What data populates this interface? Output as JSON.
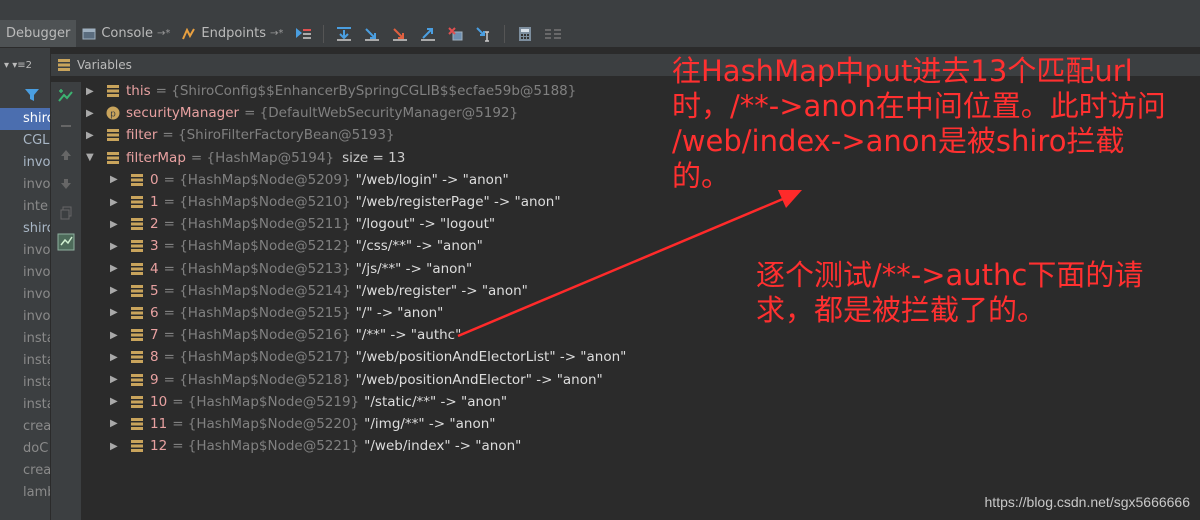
{
  "toolbar": {
    "tabs": [
      {
        "label": "Debugger",
        "active": true
      },
      {
        "label": "Console",
        "pin": "→*"
      },
      {
        "label": "Endpoints",
        "pin": "→*"
      }
    ]
  },
  "frames_panel": {
    "header": "▾ ▾≡2",
    "items": [
      {
        "label": "shiro",
        "selected": true
      },
      {
        "label": "CGLI"
      },
      {
        "label": "invo"
      },
      {
        "label": "invo",
        "dim": true
      },
      {
        "label": "inte",
        "dim": true
      },
      {
        "label": "shiro",
        "selected": false,
        "bright": true
      },
      {
        "label": "invo",
        "dim": true
      },
      {
        "label": "invo",
        "dim": true
      },
      {
        "label": "invo",
        "dim": true
      },
      {
        "label": "invo",
        "dim": true
      },
      {
        "label": "insta",
        "dim": true
      },
      {
        "label": "insta",
        "dim": true
      },
      {
        "label": "insta",
        "dim": true
      },
      {
        "label": "insta",
        "dim": true
      },
      {
        "label": "crea",
        "dim": true
      },
      {
        "label": "doC",
        "dim": true
      },
      {
        "label": "crea",
        "dim": true
      },
      {
        "label": "lamb",
        "dim": true
      }
    ]
  },
  "variables": {
    "header": "Variables",
    "top": [
      {
        "name": "this",
        "value": "= {ShiroConfig$$EnhancerBySpringCGLIB$$ecfae59b@5188}",
        "icon": "list",
        "expanded": false
      },
      {
        "name": "securityManager",
        "value": "= {DefaultWebSecurityManager@5192}",
        "icon": "field",
        "expanded": false
      },
      {
        "name": "filter",
        "value": "= {ShiroFilterFactoryBean@5193}",
        "icon": "list",
        "expanded": false
      },
      {
        "name": "filterMap",
        "value": "= {HashMap@5194}",
        "extra": "size = 13",
        "icon": "list",
        "expanded": true
      }
    ],
    "entries": [
      {
        "idx": "0",
        "node": "= {HashMap$Node@5209}",
        "entry": "\"/web/login\" -> \"anon\""
      },
      {
        "idx": "1",
        "node": "= {HashMap$Node@5210}",
        "entry": "\"/web/registerPage\" -> \"anon\""
      },
      {
        "idx": "2",
        "node": "= {HashMap$Node@5211}",
        "entry": "\"/logout\" -> \"logout\""
      },
      {
        "idx": "3",
        "node": "= {HashMap$Node@5212}",
        "entry": "\"/css/**\" -> \"anon\""
      },
      {
        "idx": "4",
        "node": "= {HashMap$Node@5213}",
        "entry": "\"/js/**\" -> \"anon\""
      },
      {
        "idx": "5",
        "node": "= {HashMap$Node@5214}",
        "entry": "\"/web/register\" -> \"anon\""
      },
      {
        "idx": "6",
        "node": "= {HashMap$Node@5215}",
        "entry": "\"/\" -> \"anon\""
      },
      {
        "idx": "7",
        "node": "= {HashMap$Node@5216}",
        "entry": "\"/**\" -> \"authc\""
      },
      {
        "idx": "8",
        "node": "= {HashMap$Node@5217}",
        "entry": "\"/web/positionAndElectorList\" -> \"anon\""
      },
      {
        "idx": "9",
        "node": "= {HashMap$Node@5218}",
        "entry": "\"/web/positionAndElector\" -> \"anon\""
      },
      {
        "idx": "10",
        "node": "= {HashMap$Node@5219}",
        "entry": "\"/static/**\" -> \"anon\""
      },
      {
        "idx": "11",
        "node": "= {HashMap$Node@5220}",
        "entry": "\"/img/**\" -> \"anon\""
      },
      {
        "idx": "12",
        "node": "= {HashMap$Node@5221}",
        "entry": "\"/web/index\" -> \"anon\""
      }
    ]
  },
  "annotations": {
    "note1": [
      "往HashMap中put进去13个匹配url",
      "时，/**->anon在中间位置。此时访问",
      "/web/index->anon是被shiro拦截",
      "的。"
    ],
    "note2": [
      "逐个测试/**->authc下面的请",
      "求，都是被拦截了的。"
    ]
  },
  "watermark": "https://blog.csdn.net/sgx5666666",
  "colors": {
    "annotation": "#ff2a2a",
    "selection": "#4b6eaf",
    "background": "#2b2b2b"
  }
}
